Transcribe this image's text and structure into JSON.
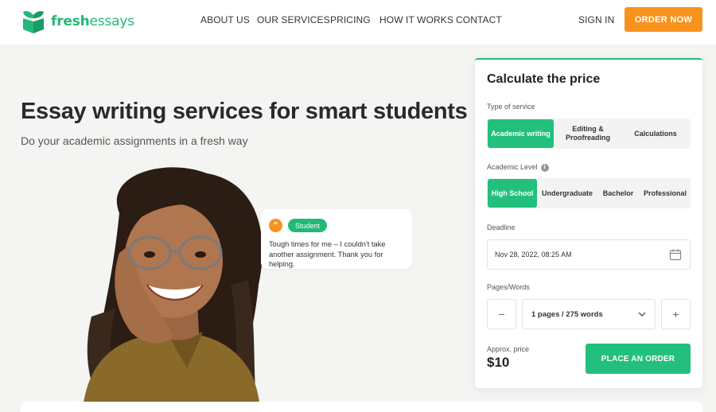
{
  "brand": {
    "name_part1": "fresh",
    "name_part2": "essays",
    "color": "#23b877"
  },
  "nav": {
    "items": [
      {
        "label": "ABOUT US"
      },
      {
        "label": "OUR SERVICES"
      },
      {
        "label": "PRICING"
      },
      {
        "label": "HOW IT WORKS"
      },
      {
        "label": "CONTACT"
      }
    ],
    "sign_in": "SIGN IN",
    "order_now": "ORDER NOW"
  },
  "hero": {
    "title": "Essay writing services for smart students",
    "subtitle": "Do your academic assignments in a fresh way"
  },
  "testimonial": {
    "quote_icon": "quote-icon",
    "badge": "Student",
    "text": "Tough times for me – I couldn't take another assignment. Thank you for helping."
  },
  "calculator": {
    "title": "Calculate the price",
    "service_label": "Type of service",
    "services": [
      {
        "label": "Academic writing",
        "active": true
      },
      {
        "label": "Editing & Proofreading",
        "active": false
      },
      {
        "label": "Calculations",
        "active": false
      }
    ],
    "level_label": "Academic Level",
    "levels": [
      {
        "label": "High School",
        "active": true
      },
      {
        "label": "Undergraduate",
        "active": false
      },
      {
        "label": "Bachelor",
        "active": false
      },
      {
        "label": "Professional",
        "active": false
      }
    ],
    "deadline_label": "Deadline",
    "deadline_value": "Nov 28, 2022, 08:25 AM",
    "pages_label": "Pages/Words",
    "decrement": "−",
    "increment": "+",
    "pages_value": "1 pages / 275 words",
    "price_label": "Approx. price",
    "price_value": "$10",
    "place_order": "PLACE AN ORDER"
  },
  "colors": {
    "accent": "#23c07d",
    "orange": "#f7921e"
  }
}
